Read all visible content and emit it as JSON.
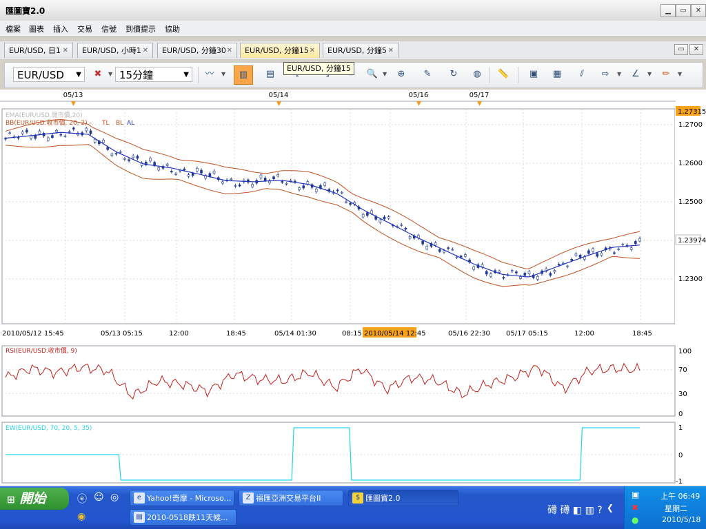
{
  "app": {
    "title": "匯圖寶2.0",
    "btn_min": "▁",
    "btn_max": "▭",
    "btn_close": "✕"
  },
  "menu": [
    "檔案",
    "圖表",
    "插入",
    "交易",
    "信號",
    "到價提示",
    "協助"
  ],
  "tabs": [
    {
      "label": "EUR/USD, 日1",
      "active": false
    },
    {
      "label": "EUR/USD, 小時1",
      "active": false
    },
    {
      "label": "EUR/USD, 分鐘30",
      "active": false
    },
    {
      "label": "EUR/USD, 分鐘15",
      "active": true
    },
    {
      "label": "EUR/USD, 分鐘5",
      "active": false
    }
  ],
  "toolbar": {
    "symbol": "EUR/USD",
    "timeframe": "15分鐘",
    "tooltip": "EUR/USD, 分鐘15"
  },
  "chart": {
    "date_markers": [
      "05/13",
      "05/14",
      "05/16",
      "05/17"
    ],
    "main_legend_1": "EMA(EUR/USD.開市價,20)",
    "main_legend_2": "BB(EUR/USD.收市價, 20, 2) -",
    "main_legend_tl": "TL",
    "main_legend_bl": "BL",
    "main_legend_al": "AL",
    "price_badge_top": "1.27315",
    "price_badge_last": "1.23974",
    "y_labels": [
      "1.2700",
      "1.2600",
      "1.2500",
      "1.2300"
    ],
    "x_labels": [
      "2010/05/12 15:45",
      "05/13 05:15",
      "12:00",
      "18:45",
      "05/14 01:30",
      "08:15",
      "2010/05/14 12:45",
      "05/16 22:30",
      "05/17 05:15",
      "12:00",
      "18:45"
    ],
    "rsi_legend": "RSI(EUR/USD.收市價, 9)",
    "rsi_y_labels": [
      "100",
      "70",
      "30",
      "0"
    ],
    "ew_legend": "EW(EUR/USD, 70, 20, 5, 35)",
    "ew_y_labels": [
      "1",
      "0",
      "-1"
    ],
    "colors": {
      "candle": "#1f3a93",
      "bb": "#c0501f",
      "ema": "#2233bb",
      "rsi": "#c0201c",
      "ew": "#22d3e6",
      "badge": "#f7a21b"
    }
  },
  "chart_data": {
    "type": "line",
    "series": [
      {
        "name": "EMA(EUR/USD.開市價,20)",
        "values": [
          1.2665,
          1.2672,
          1.268,
          1.2675,
          1.263,
          1.2598,
          1.2588,
          1.2572,
          1.2555,
          1.2552,
          1.2556,
          1.2545,
          1.2522,
          1.2478,
          1.2442,
          1.2405,
          1.2372,
          1.2338,
          1.2312,
          1.2305,
          1.2332,
          1.2358,
          1.2382,
          1.2388
        ]
      },
      {
        "name": "RSI(EUR/USD.收市價, 9)",
        "values": [
          55,
          68,
          62,
          70,
          65,
          28,
          50,
          45,
          35,
          60,
          52,
          50,
          62,
          40,
          68,
          38,
          55,
          50,
          30,
          45,
          55,
          70,
          38,
          65,
          68,
          66
        ]
      },
      {
        "name": "EW(EUR/USD, 70, 20, 5, 35)",
        "values": [
          0,
          0,
          -1,
          -1,
          -1,
          1,
          -1,
          -1,
          -1,
          -1,
          1,
          1
        ]
      }
    ]
  },
  "taskbar": {
    "start": "開始",
    "tasks": [
      {
        "label": "Yahoo!奇摩 - Microso...",
        "icon": "ie-icon"
      },
      {
        "label": "福匯亞洲交易平台II",
        "icon": "platform-icon"
      },
      {
        "label": "匯圖寶2.0",
        "icon": "dollar-icon"
      },
      {
        "label": "2010-0518跌11天候...",
        "icon": "doc-icon"
      }
    ],
    "time": "上午 06:49",
    "weekday": "星期二",
    "date": "2010/5/18"
  }
}
